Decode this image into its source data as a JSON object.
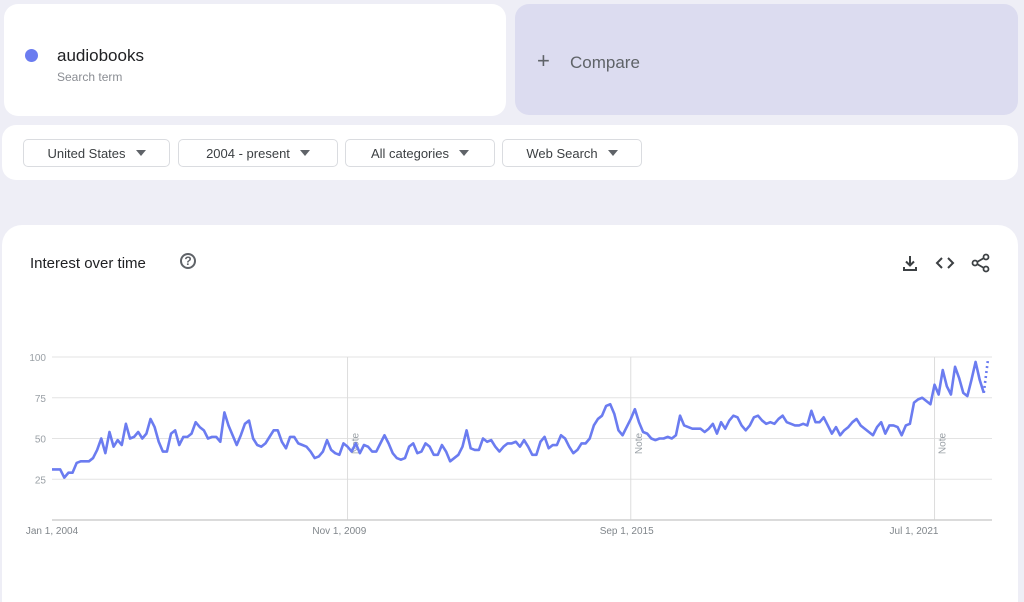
{
  "search_term": {
    "name": "audiobooks",
    "subtitle": "Search term",
    "color": "#6b7cf0"
  },
  "compare": {
    "icon": "plus-icon",
    "label": "Compare"
  },
  "filters": [
    {
      "label": "United States"
    },
    {
      "label": "2004 - present"
    },
    {
      "label": "All categories"
    },
    {
      "label": "Web Search"
    }
  ],
  "chart_header": {
    "title": "Interest over time",
    "help_icon": "?",
    "actions": [
      "download-icon",
      "embed-code-icon",
      "share-icon"
    ]
  },
  "chart_data": {
    "type": "line",
    "title": "Interest over time",
    "xlabel": "",
    "ylabel": "",
    "ylim": [
      0,
      100
    ],
    "yticks": [
      25,
      50,
      75,
      100
    ],
    "xtick_labels": [
      "Jan 1, 2004",
      "Nov 1, 2009",
      "Sep 1, 2015",
      "Jul 1, 2021"
    ],
    "xtick_months": [
      0,
      70,
      140,
      210
    ],
    "notes": [
      {
        "month": 72,
        "label": "Note"
      },
      {
        "month": 141,
        "label": "Note"
      },
      {
        "month": 215,
        "label": "Note"
      }
    ],
    "grid": true,
    "legend": "none",
    "series": [
      {
        "name": "audiobooks",
        "color": "#6b7cf0",
        "start": "Jan 2004",
        "interval": "month",
        "values": [
          31,
          31,
          31,
          26,
          29,
          29,
          35,
          36,
          36,
          36,
          38,
          43,
          50,
          41,
          54,
          45,
          49,
          46,
          59,
          50,
          51,
          54,
          50,
          53,
          62,
          57,
          48,
          42,
          42,
          53,
          55,
          46,
          51,
          51,
          53,
          60,
          57,
          55,
          50,
          51,
          51,
          48,
          66,
          58,
          52,
          46,
          52,
          59,
          61,
          50,
          46,
          45,
          47,
          51,
          55,
          55,
          48,
          44,
          51,
          51,
          47,
          46,
          45,
          42,
          38,
          39,
          42,
          49,
          43,
          41,
          40,
          47,
          45,
          42,
          47,
          41,
          46,
          45,
          42,
          42,
          47,
          52,
          47,
          41,
          38,
          37,
          38,
          45,
          47,
          41,
          42,
          47,
          45,
          40,
          40,
          46,
          42,
          36,
          38,
          40,
          45,
          55,
          44,
          43,
          43,
          50,
          48,
          49,
          45,
          42,
          45,
          47,
          47,
          48,
          45,
          49,
          45,
          40,
          40,
          48,
          51,
          44,
          46,
          46,
          52,
          50,
          45,
          41,
          43,
          47,
          47,
          50,
          58,
          62,
          64,
          70,
          71,
          65,
          55,
          52,
          57,
          62,
          68,
          60,
          54,
          53,
          50,
          49,
          50,
          50,
          51,
          50,
          52,
          64,
          58,
          57,
          56,
          56,
          56,
          54,
          56,
          59,
          53,
          60,
          56,
          61,
          64,
          63,
          58,
          55,
          58,
          63,
          64,
          61,
          59,
          60,
          59,
          62,
          64,
          60,
          59,
          58,
          58,
          59,
          58,
          67,
          60,
          60,
          63,
          58,
          53,
          57,
          52,
          55,
          57,
          60,
          62,
          58,
          56,
          54,
          52,
          57,
          60,
          53,
          58,
          58,
          57,
          52,
          58,
          59,
          72,
          74,
          75,
          73,
          71,
          83,
          77,
          92,
          82,
          77,
          94,
          87,
          78,
          76,
          86,
          97,
          86,
          78
        ],
        "partial_values": [
          78,
          98
        ]
      }
    ]
  }
}
